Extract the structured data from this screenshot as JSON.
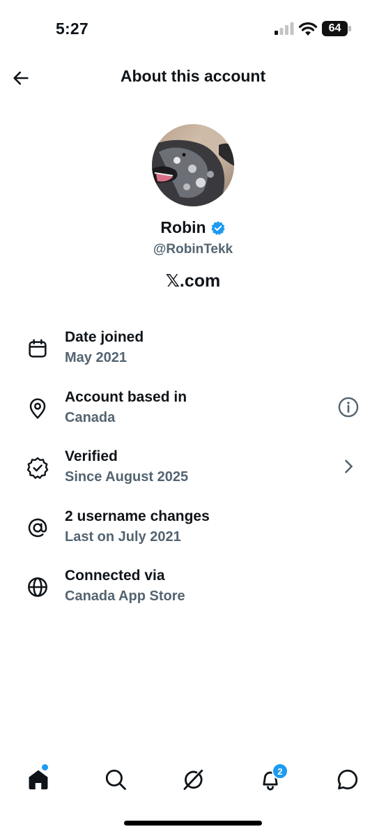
{
  "status_bar": {
    "time": "5:27",
    "battery": "64"
  },
  "header": {
    "title": "About this account"
  },
  "profile": {
    "name": "Robin",
    "handle": "@RobinTekk",
    "site": "𝕏.com",
    "verified_color": "#1d9bf0"
  },
  "rows": [
    {
      "icon": "calendar-icon",
      "title": "Date joined",
      "subtitle": "May 2021"
    },
    {
      "icon": "location-pin-icon",
      "title": "Account based in",
      "subtitle": "Canada",
      "action": "info-icon"
    },
    {
      "icon": "verified-badge-icon",
      "title": "Verified",
      "subtitle": "Since August 2025",
      "action": "chevron-right-icon"
    },
    {
      "icon": "at-sign-icon",
      "title": "2 username changes",
      "subtitle": "Last on July 2021"
    },
    {
      "icon": "globe-icon",
      "title": "Connected via",
      "subtitle": "Canada App Store"
    }
  ],
  "bottom_nav": {
    "items": [
      "home-icon",
      "search-icon",
      "grok-icon",
      "notifications-icon",
      "messages-icon"
    ],
    "notifications_count": "2"
  },
  "colors": {
    "text": "#0f1419",
    "secondary": "#536471",
    "accent": "#1d9bf0"
  }
}
